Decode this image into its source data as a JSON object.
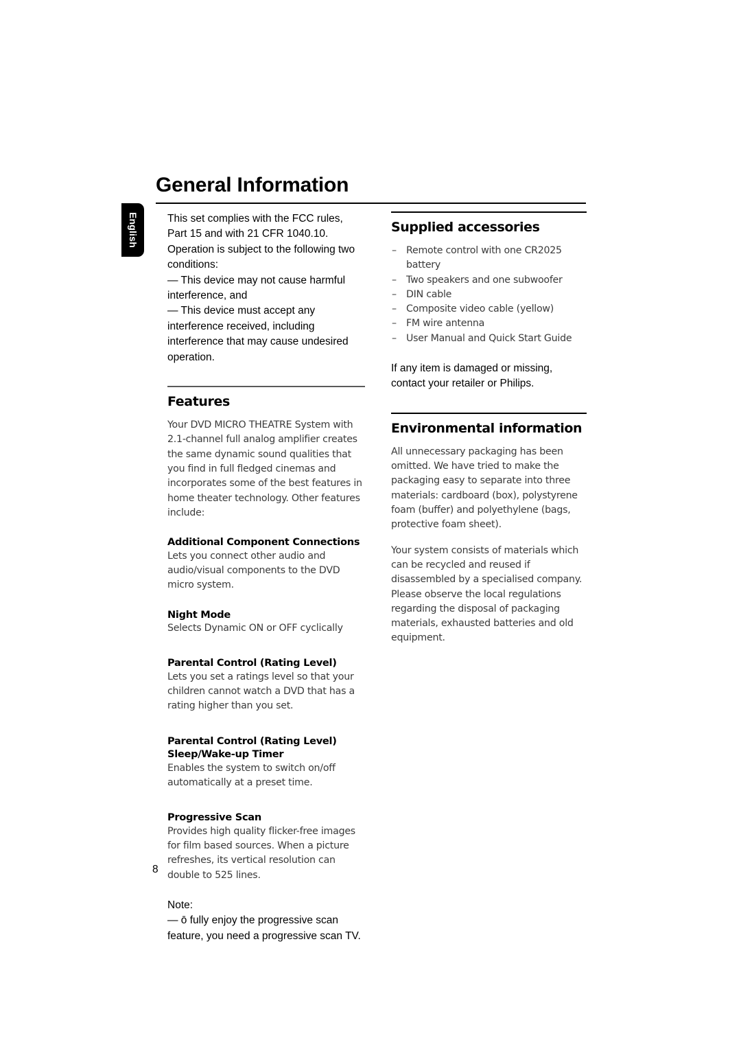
{
  "document": {
    "title": "General Information",
    "page_number": "8",
    "language_tab": "English"
  },
  "left_column": {
    "fcc_notice": {
      "paragraph": "This set complies with the FCC rules, Part 15 and with 21 CFR 1040.10. Operation is subject to the following two conditions:",
      "condition_1": "— This device may not cause harmful interference, and",
      "condition_2": "— This device must accept any interference received, including interference that may cause undesired operation."
    },
    "features": {
      "heading": "Features",
      "intro": "Your DVD MICRO THEATRE System  with 2.1-channel full analog amplifier creates the same dynamic sound qualities that you find in full fledged cinemas and incorporates some of the best features in home theater technology. Other features include:",
      "items": [
        {
          "heading": "Additional Component Connections",
          "body": "Lets you connect other audio and audio/visual components to the DVD micro system."
        },
        {
          "heading": "Night Mode",
          "body": "Selects Dynamic ON or OFF cyclically"
        },
        {
          "heading": "Parental Control (Rating Level)",
          "body": "Lets you set a ratings level so that your children cannot watch a DVD that has a rating higher than you set."
        },
        {
          "heading": "Parental Control (Rating Level)",
          "heading_line2": "Sleep/Wake-up Timer",
          "body": "Enables the system to switch on/off automatically at a preset time."
        },
        {
          "heading": "Progressive Scan",
          "body": "Provides high quality flicker-free images for film based sources. When a picture refreshes, its vertical resolution can double to 525 lines."
        }
      ]
    },
    "note": {
      "label": "Note:",
      "text": "—  ō fully enjoy the progressive scan feature, you need a progressive scan TV."
    }
  },
  "right_column": {
    "supplied_accessories": {
      "heading": "Supplied accessories",
      "bullet_symbol": "–",
      "items": [
        "Remote control with one CR2025 battery",
        "Two speakers and one subwoofer",
        "DIN cable",
        "Composite video cable (yellow)",
        "FM wire antenna",
        "User Manual and Quick Start Guide"
      ],
      "footnote": "If any item is damaged or missing, contact your retailer or Philips."
    },
    "environmental_information": {
      "heading": "Environmental information",
      "paragraph_1": "All unnecessary packaging has been omitted. We have tried to make the packaging easy to separate into three materials: cardboard (box), polystyrene foam (buffer) and polyethylene (bags, protective foam sheet).",
      "paragraph_2": "Your system consists of materials which can be recycled and reused if disassembled by a specialised company. Please observe the local regulations regarding the disposal of packaging materials, exhausted batteries and old equipment."
    }
  }
}
